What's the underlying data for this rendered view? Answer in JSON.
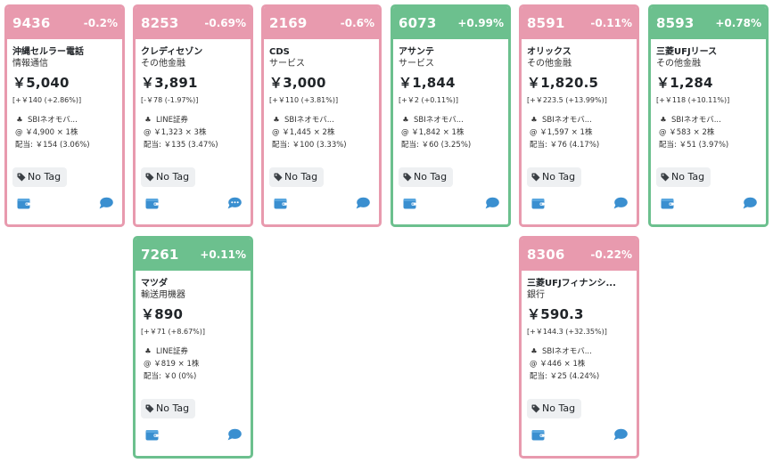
{
  "colors": {
    "down": "#e89aae",
    "up": "#6cc08e",
    "icon": "#3a8fd0"
  },
  "cards": [
    {
      "code": "9436",
      "change": "-0.2%",
      "direction": "down",
      "name": "沖縄セルラー電話",
      "sector": "情報通信",
      "price": "￥5,040",
      "gain": "[+￥140 (+2.86%)]",
      "broker": "SBIネオモバ...",
      "holding": "@ ￥4,900 × 1株",
      "dividend": "配当: ￥154 (3.06%)",
      "tag": "No Tag",
      "comment_icon": "chat-icon"
    },
    {
      "code": "8253",
      "change": "-0.69%",
      "direction": "down",
      "name": "クレディセゾン",
      "sector": "その他金融",
      "price": "￥3,891",
      "gain": "[-￥78 (-1.97%)]",
      "broker": "LINE証券",
      "holding": "@ ￥1,323 × 3株",
      "dividend": "配当: ￥135 (3.47%)",
      "tag": "No Tag",
      "comment_icon": "chat-dots-icon"
    },
    {
      "code": "2169",
      "change": "-0.6%",
      "direction": "down",
      "name": "CDS",
      "sector": "サービス",
      "price": "￥3,000",
      "gain": "[+￥110 (+3.81%)]",
      "broker": "SBIネオモバ...",
      "holding": "@ ￥1,445 × 2株",
      "dividend": "配当: ￥100 (3.33%)",
      "tag": "No Tag",
      "comment_icon": "chat-icon"
    },
    {
      "code": "6073",
      "change": "+0.99%",
      "direction": "up",
      "name": "アサンテ",
      "sector": "サービス",
      "price": "￥1,844",
      "gain": "[+￥2 (+0.11%)]",
      "broker": "SBIネオモバ...",
      "holding": "@ ￥1,842 × 1株",
      "dividend": "配当: ￥60 (3.25%)",
      "tag": "No Tag",
      "comment_icon": "chat-icon"
    },
    {
      "code": "8591",
      "change": "-0.11%",
      "direction": "down",
      "name": "オリックス",
      "sector": "その他金融",
      "price": "￥1,820.5",
      "gain": "[+￥223.5 (+13.99%)]",
      "broker": "SBIネオモバ...",
      "holding": "@ ￥1,597 × 1株",
      "dividend": "配当: ￥76 (4.17%)",
      "tag": "No Tag",
      "comment_icon": "chat-icon"
    },
    {
      "code": "8593",
      "change": "+0.78%",
      "direction": "up",
      "name": "三菱UFJリース",
      "sector": "その他金融",
      "price": "￥1,284",
      "gain": "[+￥118 (+10.11%)]",
      "broker": "SBIネオモバ...",
      "holding": "@ ￥583 × 2株",
      "dividend": "配当: ￥51 (3.97%)",
      "tag": "No Tag",
      "comment_icon": "chat-icon"
    },
    {
      "code": "7261",
      "change": "+0.11%",
      "direction": "up",
      "name": "マツダ",
      "sector": "輸送用機器",
      "price": "￥890",
      "gain": "[+￥71 (+8.67%)]",
      "broker": "LINE証券",
      "holding": "@ ￥819 × 1株",
      "dividend": "配当: ￥0 (0%)",
      "tag": "No Tag",
      "comment_icon": "chat-icon"
    },
    {
      "code": "8306",
      "change": "-0.22%",
      "direction": "down",
      "name": "三菱UFJフィナンシ...",
      "sector": "銀行",
      "price": "￥590.3",
      "gain": "[+￥144.3 (+32.35%)]",
      "broker": "SBIネオモバ...",
      "holding": "@ ￥446 × 1株",
      "dividend": "配当: ￥25 (4.24%)",
      "tag": "No Tag",
      "comment_icon": "chat-icon"
    }
  ]
}
